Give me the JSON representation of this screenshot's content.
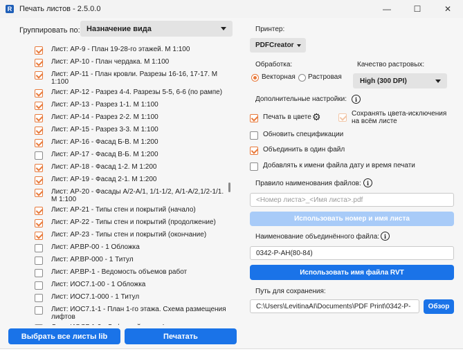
{
  "window": {
    "title": "Печать листов - 2.5.0.0",
    "app_icon": "R",
    "controls": {
      "minimize": "—",
      "maximize": "☐",
      "close": "✕"
    }
  },
  "left": {
    "group_label": "Группировать по:",
    "group_value": "Назначение вида",
    "sheets": [
      {
        "label": "Лист: АР-9 - План 19-28-го этажей. М 1:100",
        "checked": true
      },
      {
        "label": "Лист: АР-10 - План чердака. М 1:100",
        "checked": true
      },
      {
        "label": "Лист: АР-11 - План кровли. Разрезы 16-16, 17-17. М 1:100",
        "checked": true
      },
      {
        "label": "Лист: АР-12 - Разрез 4-4. Разрезы 5-5, 6-6 (по рампе)",
        "checked": true
      },
      {
        "label": "Лист: АР-13 - Разрез 1-1. М 1:100",
        "checked": true
      },
      {
        "label": "Лист: АР-14 - Разрез 2-2. М 1:100",
        "checked": true
      },
      {
        "label": "Лист: АР-15 - Разрез 3-3. М 1:100",
        "checked": true
      },
      {
        "label": "Лист: АР-16 - Фасад Б-В. М 1:200",
        "checked": true
      },
      {
        "label": "Лист: АР-17 - Фасад В-Б. М 1:200",
        "checked": false
      },
      {
        "label": "Лист: АР-18 - Фасад 1-2. М 1:200",
        "checked": true
      },
      {
        "label": "Лист: АР-19 - Фасад 2-1. М 1:200",
        "checked": true
      },
      {
        "label": "Лист: АР-20 - Фасады А/2-А/1, 1/1-1/2, А/1-А/2,1/2-1/1. М 1:100",
        "checked": true
      },
      {
        "label": "Лист: АР-21 - Типы стен и покрытий (начало)",
        "checked": true
      },
      {
        "label": "Лист: АР-22 - Типы стен и покрытий (продолжение)",
        "checked": true
      },
      {
        "label": "Лист: АР-23 - Типы стен и покрытий (окончание)",
        "checked": true
      },
      {
        "label": "Лист: АР.ВР-00 - 1 Обложка",
        "checked": false
      },
      {
        "label": "Лист: АР.ВР-000 - 1 Титул",
        "checked": false
      },
      {
        "label": "Лист: АР.ВР-1 - Ведомость объемов работ",
        "checked": false
      },
      {
        "label": "Лист: ИОС7.1-00 - 1 Обложка",
        "checked": false
      },
      {
        "label": "Лист: ИОС7.1-000 - 1 Титул",
        "checked": false
      },
      {
        "label": "Лист: ИОС7.1-1 - План 1-го этажа. Схема размещения лифтов",
        "checked": false
      },
      {
        "label": "Лист: ИОС7.1-2 - Лифтовый узел. Фрагменты планов. Разрезы",
        "checked": false
      }
    ],
    "select_all_button": "Выбрать все листы lib",
    "print_button": "Печатать"
  },
  "right": {
    "printer_label": "Принтер:",
    "printer_value": "PDFCreator",
    "processing_label": "Обработка:",
    "vector_label": "Векторная",
    "raster_label": "Растровая",
    "processing_mode": "vector",
    "quality_label": "Качество растровых:",
    "quality_value": "High (300 DPI)",
    "extra_label": "Дополнительные настройки:",
    "color_print_label": "Печать в цвете",
    "color_print_checked": true,
    "keep_colors_label_1": "Сохранять цвета-исключения",
    "keep_colors_label_2": "на всём листе",
    "keep_colors_checked": true,
    "update_specs_label": "Обновить спецификации",
    "update_specs_checked": false,
    "merge_label": "Объединить в один файл",
    "merge_checked": true,
    "add_date_label": "Добавлять к имени файла дату и время печати",
    "add_date_checked": false,
    "naming_rule_label": "Правило наименования файлов:",
    "naming_rule_placeholder": "<Номер листа>_<Имя листа>.pdf",
    "use_number_name_button": "Использовать номер и имя листа",
    "merged_name_label": "Наименование объединённого файла:",
    "merged_name_value": "0342-Р-АН(80-84)",
    "use_rvt_button": "Использовать имя файла RVT",
    "save_path_label": "Путь для сохранения:",
    "save_path_value": "C:\\Users\\LevitinaAI\\Documents\\PDF Print\\0342-Р-",
    "browse_button": "Обзор",
    "info_glyph": "i",
    "gear_glyph": "⚙"
  },
  "colors": {
    "accent": "#e8793a",
    "primary": "#1a73e8",
    "disabled": "#a8cbf8"
  }
}
